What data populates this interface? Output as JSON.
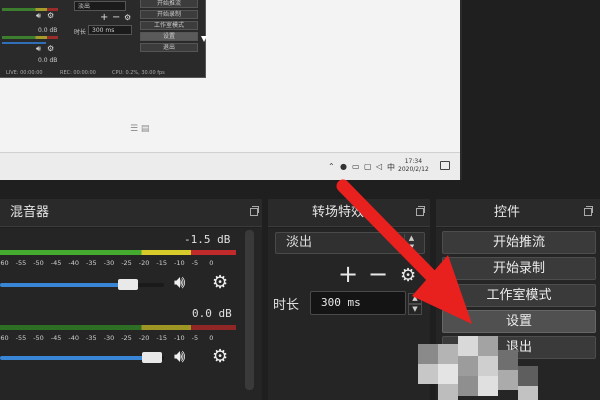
{
  "preview": {
    "nested_obs": {
      "mini_db": [
        "0.0 dB",
        "0.0 dB"
      ],
      "transition": "淡出",
      "duration_label": "时长",
      "duration_value": "300 ms",
      "buttons": [
        "开始推流",
        "开始录制",
        "工作室模式",
        "设置",
        "退出"
      ],
      "status": [
        "LIVE: 00:00:00",
        "REC: 00:00:00",
        "CPU: 0.2%, 30.00 fps"
      ]
    },
    "taskbar": {
      "clock_time": "17:34",
      "clock_date": "2020/2/12"
    }
  },
  "mixer": {
    "title": "混音器",
    "tracks": [
      {
        "db": "-1.5 dB",
        "volume_fraction": 0.79
      },
      {
        "db": "0.0 dB",
        "volume_fraction": 0.95
      }
    ],
    "ticks": [
      "-60",
      "-55",
      "-50",
      "-45",
      "-40",
      "-35",
      "-30",
      "-25",
      "-20",
      "-15",
      "-10",
      "-5",
      "0"
    ]
  },
  "transitions": {
    "title": "转场特效",
    "selected": "淡出",
    "duration_label": "时长",
    "duration_value": "300 ms"
  },
  "controls": {
    "title": "控件",
    "buttons": [
      "开始推流",
      "开始录制",
      "工作室模式",
      "设置",
      "退出"
    ],
    "hovered_index": 3
  },
  "colors": {
    "annotation_arrow": "#e8201e",
    "fader_blue": "#3a86d6",
    "panel_bg": "#252525"
  }
}
